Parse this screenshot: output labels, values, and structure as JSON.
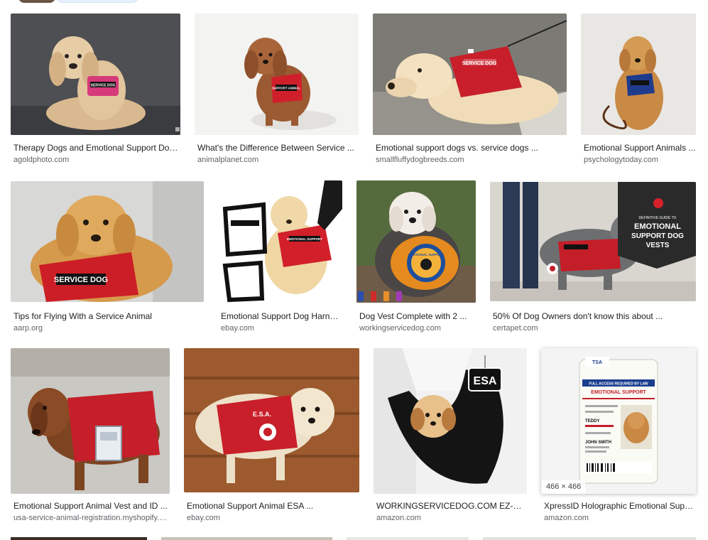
{
  "results": [
    {
      "title": "Therapy Dogs and Emotional Support Dogs ...",
      "source": "agoldphoto.com"
    },
    {
      "title": "What's the Difference Between Service ...",
      "source": "animalplanet.com"
    },
    {
      "title": "Emotional support dogs vs. service dogs ...",
      "source": "smallfluffydogbreeds.com"
    },
    {
      "title": "Emotional Support Animals ...",
      "source": "psychologytoday.com"
    },
    {
      "title": "Tips for Flying With a Service Animal",
      "source": "aarp.org"
    },
    {
      "title": "Emotional Support Dog Harness ...",
      "source": "ebay.com"
    },
    {
      "title": "Dog Vest Complete with 2 ...",
      "source": "workingservicedog.com"
    },
    {
      "title": "50% Of Dog Owners don't know this about ...",
      "source": "certapet.com"
    },
    {
      "title": "Emotional Support Animal Vest and ID ...",
      "source": "usa-service-animal-registration.myshopify.com"
    },
    {
      "title": "Emotional Support Animal ESA ...",
      "source": "ebay.com"
    },
    {
      "title": "WORKINGSERVICEDOG.COM EZ-Sling ...",
      "source": "amazon.com"
    },
    {
      "title": "XpressID Holographic Emotional Support ...",
      "source": "amazon.com"
    }
  ],
  "image_text": {
    "vest_service_dog": "SERVICE DOG",
    "vest_support_animal": "SUPPORT ANIMAL",
    "vest_emotional_support": "EMOTIONAL SUPPORT",
    "patch_emotional_support": "EMOTIONAL SUPPORT",
    "vest_esa": "E.S.A.",
    "sling_esa": "ESA",
    "guide_line1": "DEFINITIVE GUIDE TO",
    "guide_line2": "EMOTIONAL",
    "guide_line3": "SUPPORT DOG",
    "guide_line4": "VESTS",
    "badge_esa": "ESA",
    "card_full_access": "FULL ACCESS REQUIRED BY LAW",
    "card_emotional_support": "EMOTIONAL SUPPORT",
    "card_name": "TEDDY",
    "card_handler": "JOHN SMITH",
    "card_logo": "TSA"
  },
  "selected_image": {
    "dimensions": "466 × 466"
  },
  "colors": {
    "vest_red": "#c8202a",
    "caption_title": "#202124",
    "caption_source": "#5f6368"
  }
}
